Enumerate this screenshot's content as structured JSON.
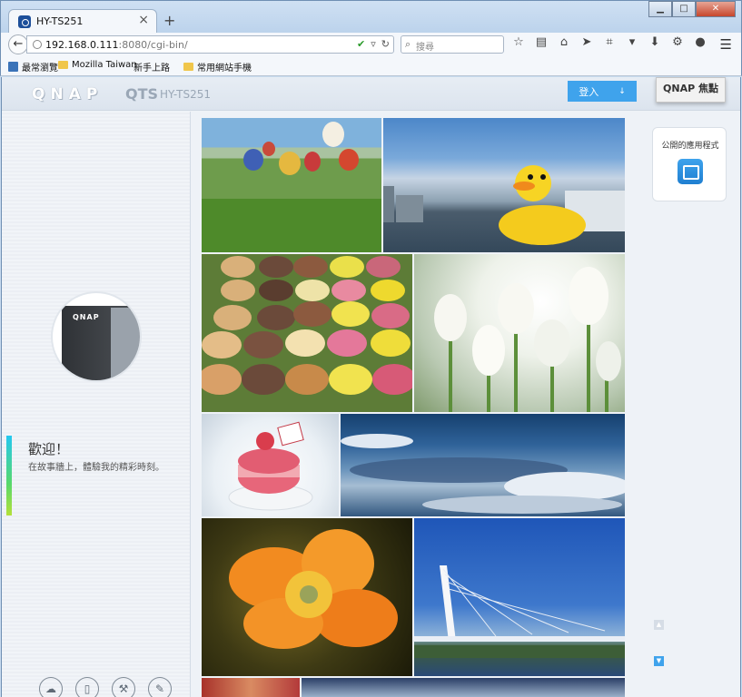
{
  "browser": {
    "tab_title": "HY-TS251",
    "tab_close": "×",
    "new_tab": "+",
    "window_buttons": {
      "minimize": "▁",
      "maximize": "□",
      "close": "✕"
    },
    "url_host": "192.168.0.111",
    "url_rest": ":8080/cgi-bin/",
    "search_placeholder": "搜尋",
    "bookmarks": [
      "最常瀏覽",
      "Mozilla Taiwan",
      "新手上路",
      "常用網站",
      "手機"
    ]
  },
  "header": {
    "logo": "QNAP",
    "product": "QTS",
    "model": "HY-TS251",
    "login_label": "登入",
    "spotlight_label": "QNAP 焦點"
  },
  "left": {
    "device_logo": "QNAP",
    "welcome_title": "歡迎！",
    "welcome_sub": "在故事牆上，體驗我的精彩時刻。",
    "bottom_icons": [
      "cloud-icon",
      "mobile-icon",
      "hammer-icon",
      "pencil-icon"
    ]
  },
  "right": {
    "apps_title": "公開的應用程式"
  },
  "gallery": {
    "photos": [
      "hot-air-balloons",
      "rubber-duck-harbor",
      "macarons",
      "white-tulips",
      "macaron-cake",
      "cloudy-sky",
      "orange-poppy",
      "cable-bridge"
    ]
  },
  "colors": {
    "accent_blue": "#3fa3ec",
    "page_bg": "#eef2f7"
  }
}
